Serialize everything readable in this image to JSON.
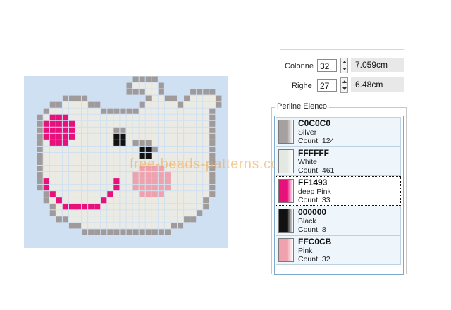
{
  "watermark": "free-beads-patterns.com",
  "grid": {
    "columns_value": "32",
    "rows_value": "27",
    "columns_label": "Colonne",
    "rows_label": "Righe",
    "width_cm": "7.059cm",
    "height_cm": "6.48cm"
  },
  "list": {
    "title": "Perline Elenco",
    "items": [
      {
        "code": "C0C0C0",
        "name": "Silver",
        "count": "Count: 124",
        "color": "#a6a0a0",
        "selected": false
      },
      {
        "code": "FFFFFF",
        "name": "White",
        "count": "Count: 461",
        "color": "#e4e8e2",
        "selected": false
      },
      {
        "code": "FF1493",
        "name": "deep Pink",
        "count": "Count: 33",
        "color": "#e8117c",
        "selected": true
      },
      {
        "code": "000000",
        "name": "Black",
        "count": "Count: 8",
        "color": "#111111",
        "selected": false
      },
      {
        "code": "FFC0CB",
        "name": "Pink",
        "count": "Count: 32",
        "color": "#efa2ad",
        "selected": false
      }
    ]
  },
  "colors": {
    "grid_bg": "#cfe0f2",
    "grid_line": "#7f9ecb",
    "silver": "#a09a9a",
    "white": "#ecebe3",
    "deep_pink": "#e8117c",
    "black": "#111111",
    "pink": "#efa2ad"
  }
}
